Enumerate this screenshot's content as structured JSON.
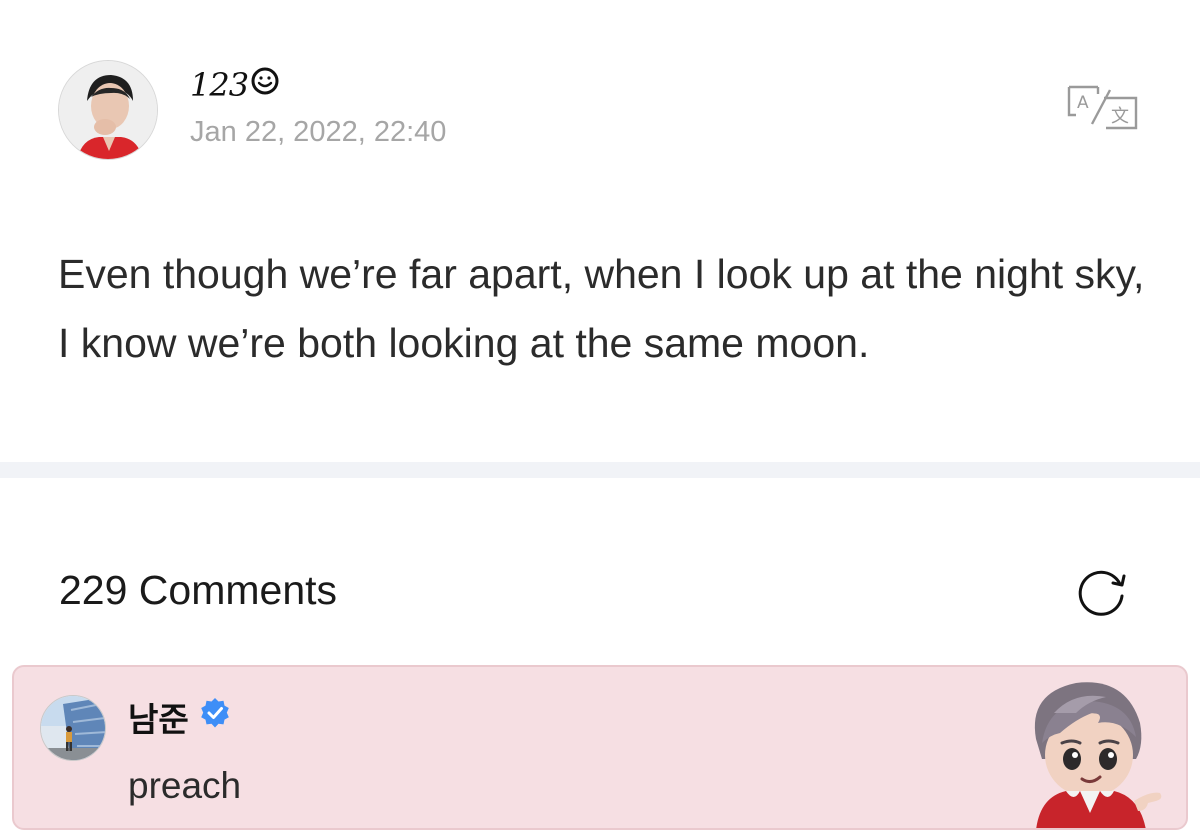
{
  "post": {
    "author_name": "123",
    "author_emoticon_icon": "smiley-icon",
    "date": "Jan 22, 2022, 22:40",
    "translate_icon": "translate-icon",
    "body": "Even though we’re far apart, when I look up at the night sky, I know we’re both looking at the same moon."
  },
  "comments": {
    "count_label": "229 Comments",
    "refresh_icon": "refresh-icon",
    "items": [
      {
        "author": "남준",
        "verified": true,
        "text": "preach",
        "sticker_icon": "character-sticker"
      }
    ]
  },
  "colors": {
    "highlight_card": "#f6dfe3",
    "verified_badge": "#3e8ef7",
    "date_text": "#a6a6a6",
    "divider": "#f1f3f7"
  }
}
